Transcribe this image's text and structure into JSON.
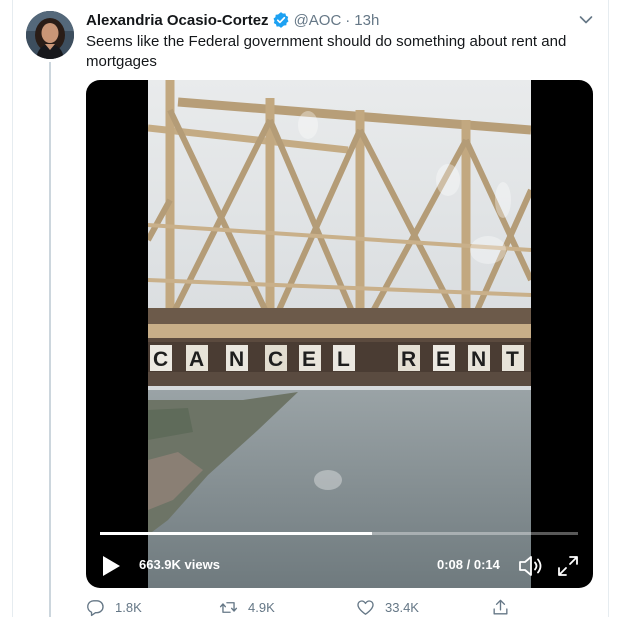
{
  "tweet": {
    "author_name": "Alexandria Ocasio-Cortez",
    "handle": "@AOC",
    "separator": "·",
    "time": "13h",
    "text": "Seems like the Federal government should do something about rent and mortgages",
    "verified_icon": "verified-badge-icon",
    "menu_icon": "chevron-down-icon"
  },
  "media": {
    "banner_letters": [
      "C",
      "A",
      "N",
      "C",
      "E",
      "L",
      "R",
      "E",
      "N",
      "T"
    ],
    "views": "663.9K views",
    "timecode": "0:08 / 0:14",
    "progress": 0.57,
    "icons": [
      "play-icon",
      "volume-icon",
      "fullscreen-icon"
    ]
  },
  "actions": {
    "replies": "1.8K",
    "retweets": "4.9K",
    "likes": "33.4K",
    "icons": [
      "reply-icon",
      "retweet-icon",
      "like-icon",
      "share-icon"
    ]
  },
  "colors": {
    "verified": "#1da1f2",
    "secondary_text": "#657786",
    "primary_text": "#14171a"
  }
}
